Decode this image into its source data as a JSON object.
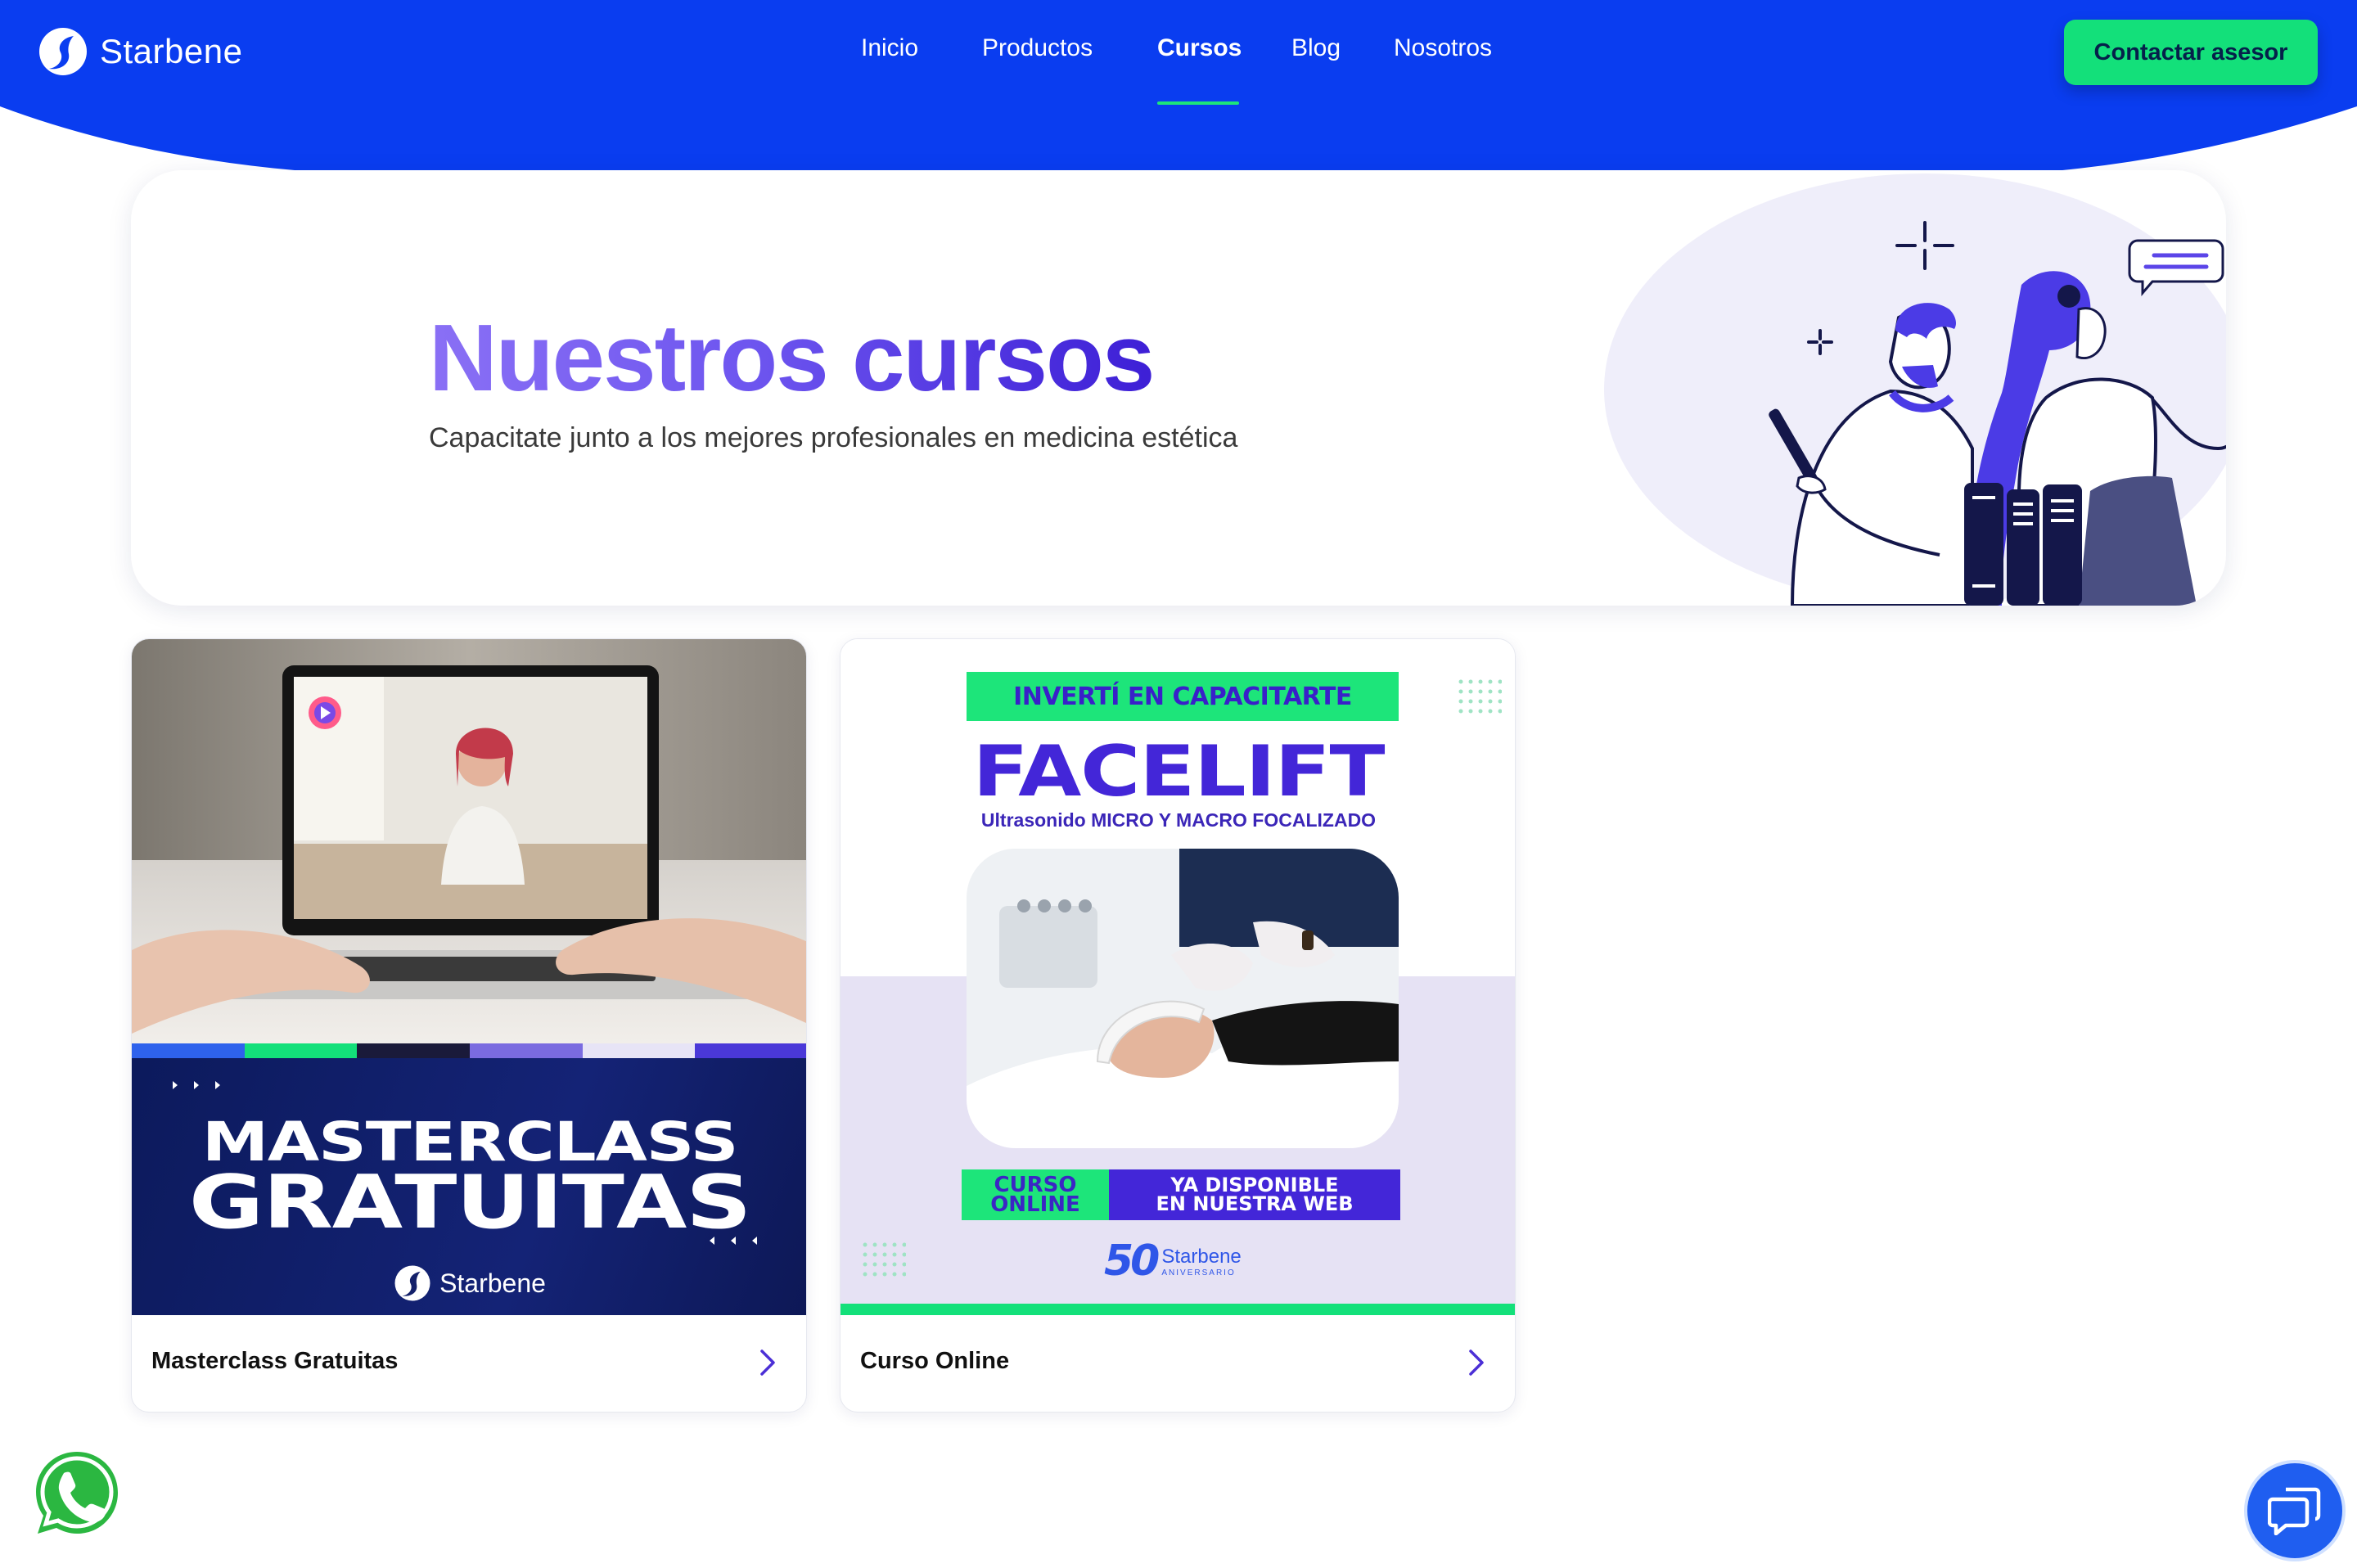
{
  "header": {
    "brand": "Starbene",
    "nav": [
      {
        "label": "Inicio"
      },
      {
        "label": "Productos"
      },
      {
        "label": "Cursos",
        "active": true
      },
      {
        "label": "Blog"
      },
      {
        "label": "Nosotros"
      }
    ],
    "cta_label": "Contactar asesor"
  },
  "hero": {
    "title": "Nuestros cursos",
    "subtitle": "Capacitate junto a los mejores profesionales en medicina estética"
  },
  "courses": [
    {
      "label": "Masterclass Gratuitas",
      "image": {
        "line1": "MASTERCLASS",
        "line2": "GRATUITAS",
        "brand": "Starbene"
      }
    },
    {
      "label": "Curso Online",
      "image": {
        "tag": "INVERTÍ EN CAPACITARTE",
        "title": "FACELIFT",
        "subtitle": "Ultrasonido MICRO Y MACRO FOCALIZADO",
        "online_line1": "CURSO",
        "online_line2": "ONLINE",
        "avail_line1": "YA DISPONIBLE",
        "avail_line2": "EN NUESTRA WEB",
        "logo_number": "50",
        "logo_brand": "Starbene",
        "logo_tag": "ANIVERSARIO"
      }
    }
  ],
  "colors": {
    "header_blue": "#0a3df0",
    "accent_green": "#13e07a",
    "title_purple": "#4326d8"
  },
  "icons": {
    "whatsapp": "whatsapp-icon",
    "chat": "chat-bubbles-icon",
    "chevron": "chevron-right-icon"
  }
}
